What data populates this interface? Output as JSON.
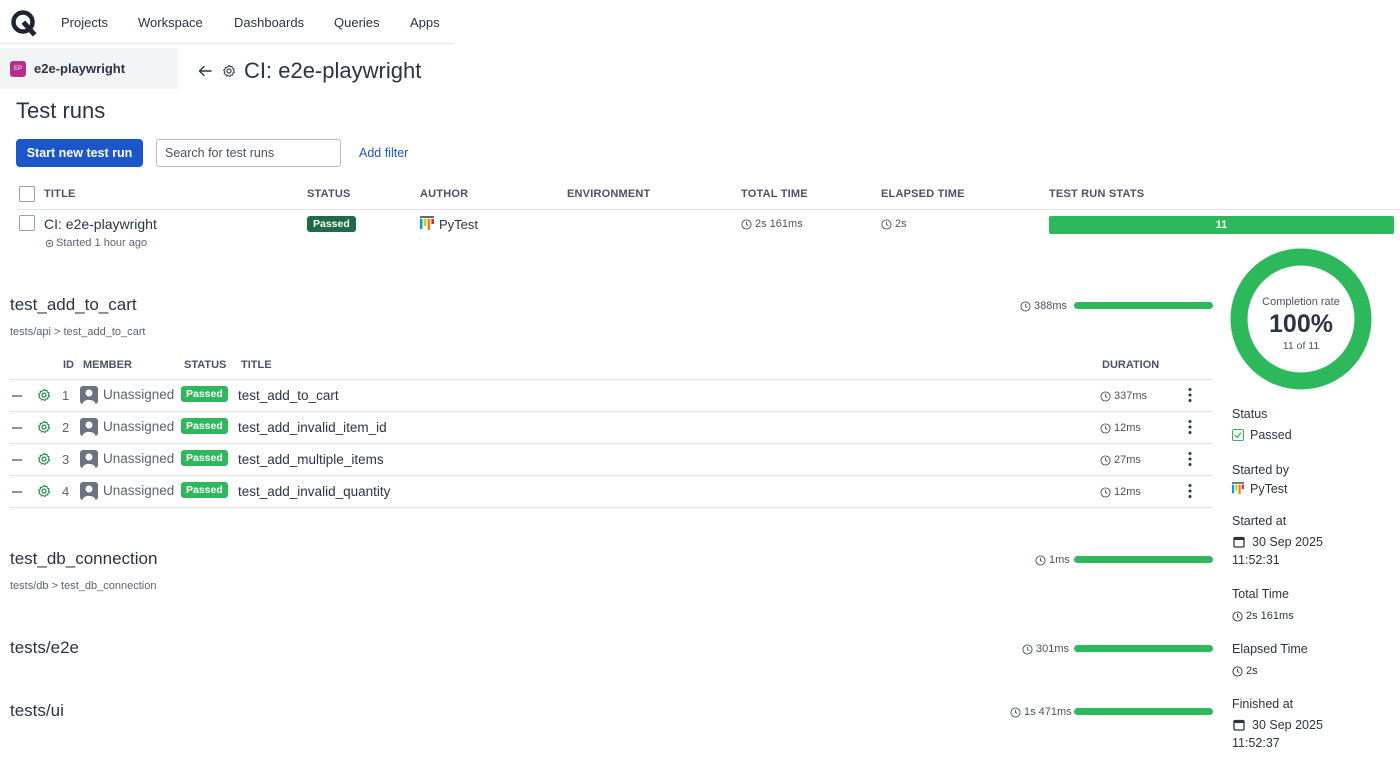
{
  "nav": {
    "items": [
      "Projects",
      "Workspace",
      "Dashboards",
      "Queries",
      "Apps"
    ]
  },
  "project": {
    "badge": "EP",
    "name": "e2e-playwright"
  },
  "page": {
    "title": "CI: e2e-playwright"
  },
  "test_runs": {
    "heading": "Test runs",
    "start_button": "Start new test run",
    "search_placeholder": "Search for test runs",
    "add_filter": "Add filter",
    "columns": [
      "TITLE",
      "STATUS",
      "AUTHOR",
      "ENVIRONMENT",
      "TOTAL TIME",
      "ELAPSED TIME",
      "TEST RUN STATS"
    ],
    "row": {
      "title": "CI: e2e-playwright",
      "started": "Started 1 hour ago",
      "status": "Passed",
      "author": "PyTest",
      "environment": "",
      "total_time": "2s 161ms",
      "elapsed_time": "2s",
      "stats_count": "11",
      "stats_passed_fraction": 1.0
    }
  },
  "suites": [
    {
      "title": "test_add_to_cart",
      "path": "tests/api > test_add_to_cart",
      "duration": "388ms",
      "progress_fraction": 1.0,
      "columns": [
        "ID",
        "MEMBER",
        "STATUS",
        "TITLE",
        "DURATION"
      ],
      "cases": [
        {
          "id": "1",
          "member": "Unassigned",
          "status": "Passed",
          "title": "test_add_to_cart",
          "duration": "337ms"
        },
        {
          "id": "2",
          "member": "Unassigned",
          "status": "Passed",
          "title": "test_add_invalid_item_id",
          "duration": "12ms"
        },
        {
          "id": "3",
          "member": "Unassigned",
          "status": "Passed",
          "title": "test_add_multiple_items",
          "duration": "27ms"
        },
        {
          "id": "4",
          "member": "Unassigned",
          "status": "Passed",
          "title": "test_add_invalid_quantity",
          "duration": "12ms"
        }
      ]
    },
    {
      "title": "test_db_connection",
      "path": "tests/db > test_db_connection",
      "duration": "1ms",
      "progress_fraction": 1.0
    },
    {
      "title": "tests/e2e",
      "duration": "301ms",
      "progress_fraction": 1.0
    },
    {
      "title": "tests/ui",
      "duration": "1s 471ms",
      "progress_fraction": 1.0
    }
  ],
  "summary": {
    "completion_label": "Completion rate",
    "completion_value": "100%",
    "completion_count": "11 of 11",
    "completion_fraction": 1.0,
    "status_label": "Status",
    "status_value": "Passed",
    "started_by_label": "Started by",
    "started_by_value": "PyTest",
    "started_at_label": "Started at",
    "started_at_date": "30 Sep 2025",
    "started_at_time": "11:52:31",
    "total_time_label": "Total Time",
    "total_time_value": "2s 161ms",
    "elapsed_time_label": "Elapsed Time",
    "elapsed_time_value": "2s",
    "finished_at_label": "Finished at",
    "finished_at_date": "30 Sep 2025",
    "finished_at_time": "11:52:37"
  },
  "colors": {
    "accent": "#1b57c9",
    "success": "#2eb85c",
    "success_dark": "#1e6b45",
    "text": "#2b3445"
  }
}
